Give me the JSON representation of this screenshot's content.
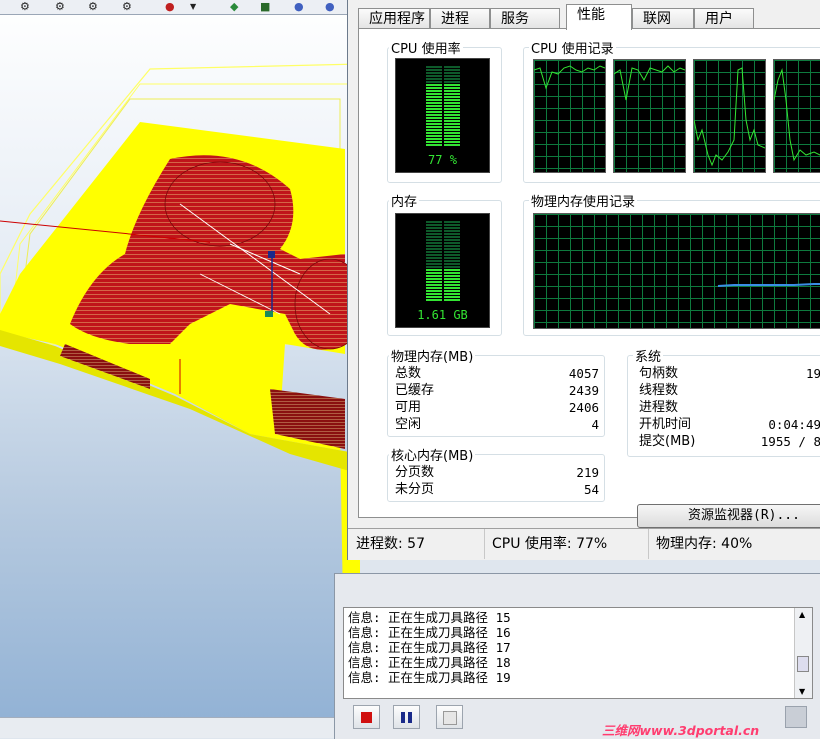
{
  "cad": {
    "colors": {
      "stock": "#ffff00",
      "part": "#c0141a",
      "toolpath_wire": "#ffff66",
      "background_top": "#ffffff",
      "background_bottom": "#8fb0d4"
    },
    "toolbar_icons": [
      "toolpath-icon",
      "toolpath-icon",
      "toolpath-icon",
      "toolpath-icon",
      "material-icon",
      "dropdown-arrow-icon",
      "simulate-icon",
      "machine-icon",
      "sphere-icon"
    ]
  },
  "taskmgr": {
    "tabs": [
      "应用程序",
      "进程",
      "服务",
      "性能",
      "联网",
      "用户"
    ],
    "active_tab": "性能",
    "cpu_usage": {
      "label": "CPU 使用率",
      "value_text": "77 %",
      "percent": 77
    },
    "cpu_history": {
      "label": "CPU 使用记录"
    },
    "memory": {
      "label": "内存",
      "value_text": "1.61 GB",
      "fraction": 0.4
    },
    "memory_history": {
      "label": "物理内存使用记录"
    },
    "physical_memory": {
      "label": "物理内存(MB)",
      "rows": [
        {
          "label": "总数",
          "value": "4057"
        },
        {
          "label": "已缓存",
          "value": "2439"
        },
        {
          "label": "可用",
          "value": "2406"
        },
        {
          "label": "空闲",
          "value": "4"
        }
      ]
    },
    "kernel_memory": {
      "label": "核心内存(MB)",
      "rows": [
        {
          "label": "分页数",
          "value": "219"
        },
        {
          "label": "未分页",
          "value": "54"
        }
      ]
    },
    "system": {
      "label": "系统",
      "rows": [
        {
          "label": "句柄数",
          "value": "19"
        },
        {
          "label": "线程数",
          "value": ""
        },
        {
          "label": "进程数",
          "value": ""
        },
        {
          "label": "开机时间",
          "value": "0:04:49"
        },
        {
          "label": "提交(MB)",
          "value": "1955 / 8"
        }
      ]
    },
    "resource_monitor_button": "资源监视器(R)...",
    "status_bar": {
      "processes": "进程数: 57",
      "cpu": "CPU 使用率: 77%",
      "memory": "物理内存: 40%"
    },
    "graph_colors": {
      "grid": "#0e7a3e",
      "line": "#33e533",
      "memory_line": "#3a8ee6"
    }
  },
  "log": {
    "lines": [
      "信息: 正在生成刀具路径 15",
      "信息: 正在生成刀具路径 16",
      "信息: 正在生成刀具路径 17",
      "信息: 正在生成刀具路径 18",
      "信息: 正在生成刀具路径 19"
    ],
    "buttons": [
      "stop-icon",
      "pause-icon",
      "step-icon"
    ],
    "watermark": "三维网www.3dportal.cn"
  }
}
